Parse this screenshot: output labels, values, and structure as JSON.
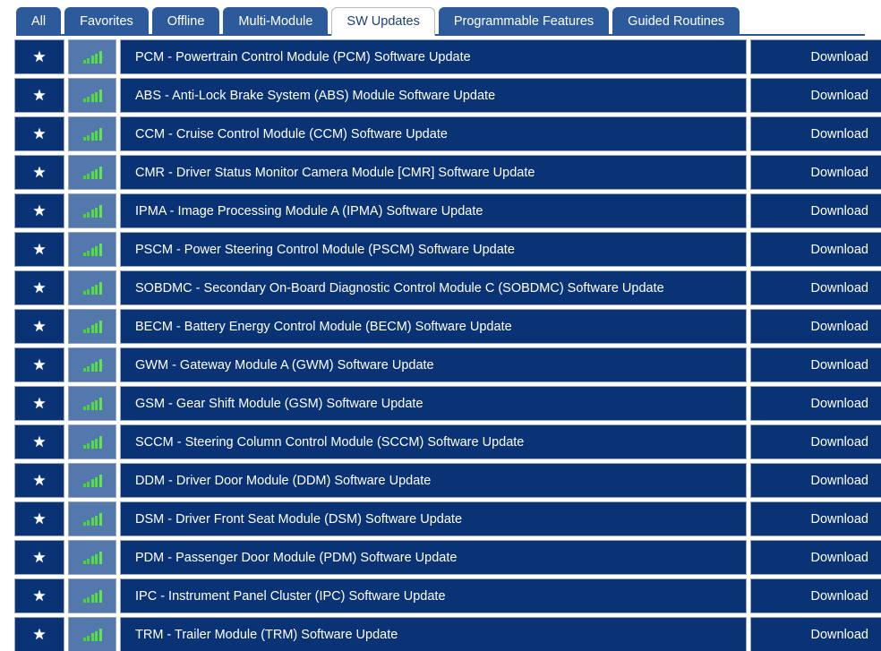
{
  "tabs": [
    {
      "label": "All",
      "active": false
    },
    {
      "label": "Favorites",
      "active": false
    },
    {
      "label": "Offline",
      "active": false
    },
    {
      "label": "Multi-Module",
      "active": false
    },
    {
      "label": "SW Updates",
      "active": true
    },
    {
      "label": "Programmable Features",
      "active": false
    },
    {
      "label": "Guided Routines",
      "active": false
    }
  ],
  "colors": {
    "tab_blue": "#2c5a9b",
    "row_navy": "#0a3375",
    "signal_cell": "#5378ab",
    "signal_green": "#55dc42",
    "page_background": "#ffffff",
    "active_tab_text": "#1b3f77",
    "row_text": "#ffffff"
  },
  "list": {
    "action_label": "Download",
    "favorite_icon": "star-icon",
    "signal_icon": "signal-bars-icon",
    "signal_bars": 5,
    "rows": [
      {
        "name": "PCM - Powertrain Control Module (PCM) Software Update",
        "action": "Download"
      },
      {
        "name": "ABS - Anti-Lock Brake System (ABS) Module Software Update",
        "action": "Download"
      },
      {
        "name": "CCM - Cruise Control Module (CCM) Software Update",
        "action": "Download"
      },
      {
        "name": "CMR - Driver Status Monitor Camera Module [CMR] Software Update",
        "action": "Download"
      },
      {
        "name": "IPMA - Image Processing Module A (IPMA) Software Update",
        "action": "Download"
      },
      {
        "name": "PSCM - Power Steering Control Module (PSCM) Software Update",
        "action": "Download"
      },
      {
        "name": "SOBDMC - Secondary On-Board Diagnostic Control Module C (SOBDMC) Software Update",
        "action": "Download"
      },
      {
        "name": "BECM - Battery Energy Control Module (BECM) Software Update",
        "action": "Download"
      },
      {
        "name": "GWM - Gateway Module A (GWM) Software Update",
        "action": "Download"
      },
      {
        "name": "GSM - Gear Shift Module (GSM) Software Update",
        "action": "Download"
      },
      {
        "name": "SCCM - Steering Column Control Module (SCCM) Software Update",
        "action": "Download"
      },
      {
        "name": "DDM - Driver Door Module (DDM) Software Update",
        "action": "Download"
      },
      {
        "name": "DSM - Driver Front Seat Module (DSM) Software Update",
        "action": "Download"
      },
      {
        "name": "PDM - Passenger Door Module (PDM) Software Update",
        "action": "Download"
      },
      {
        "name": "IPC - Instrument Panel Cluster (IPC) Software Update",
        "action": "Download"
      },
      {
        "name": "TRM - Trailer Module (TRM) Software Update",
        "action": "Download"
      }
    ]
  }
}
